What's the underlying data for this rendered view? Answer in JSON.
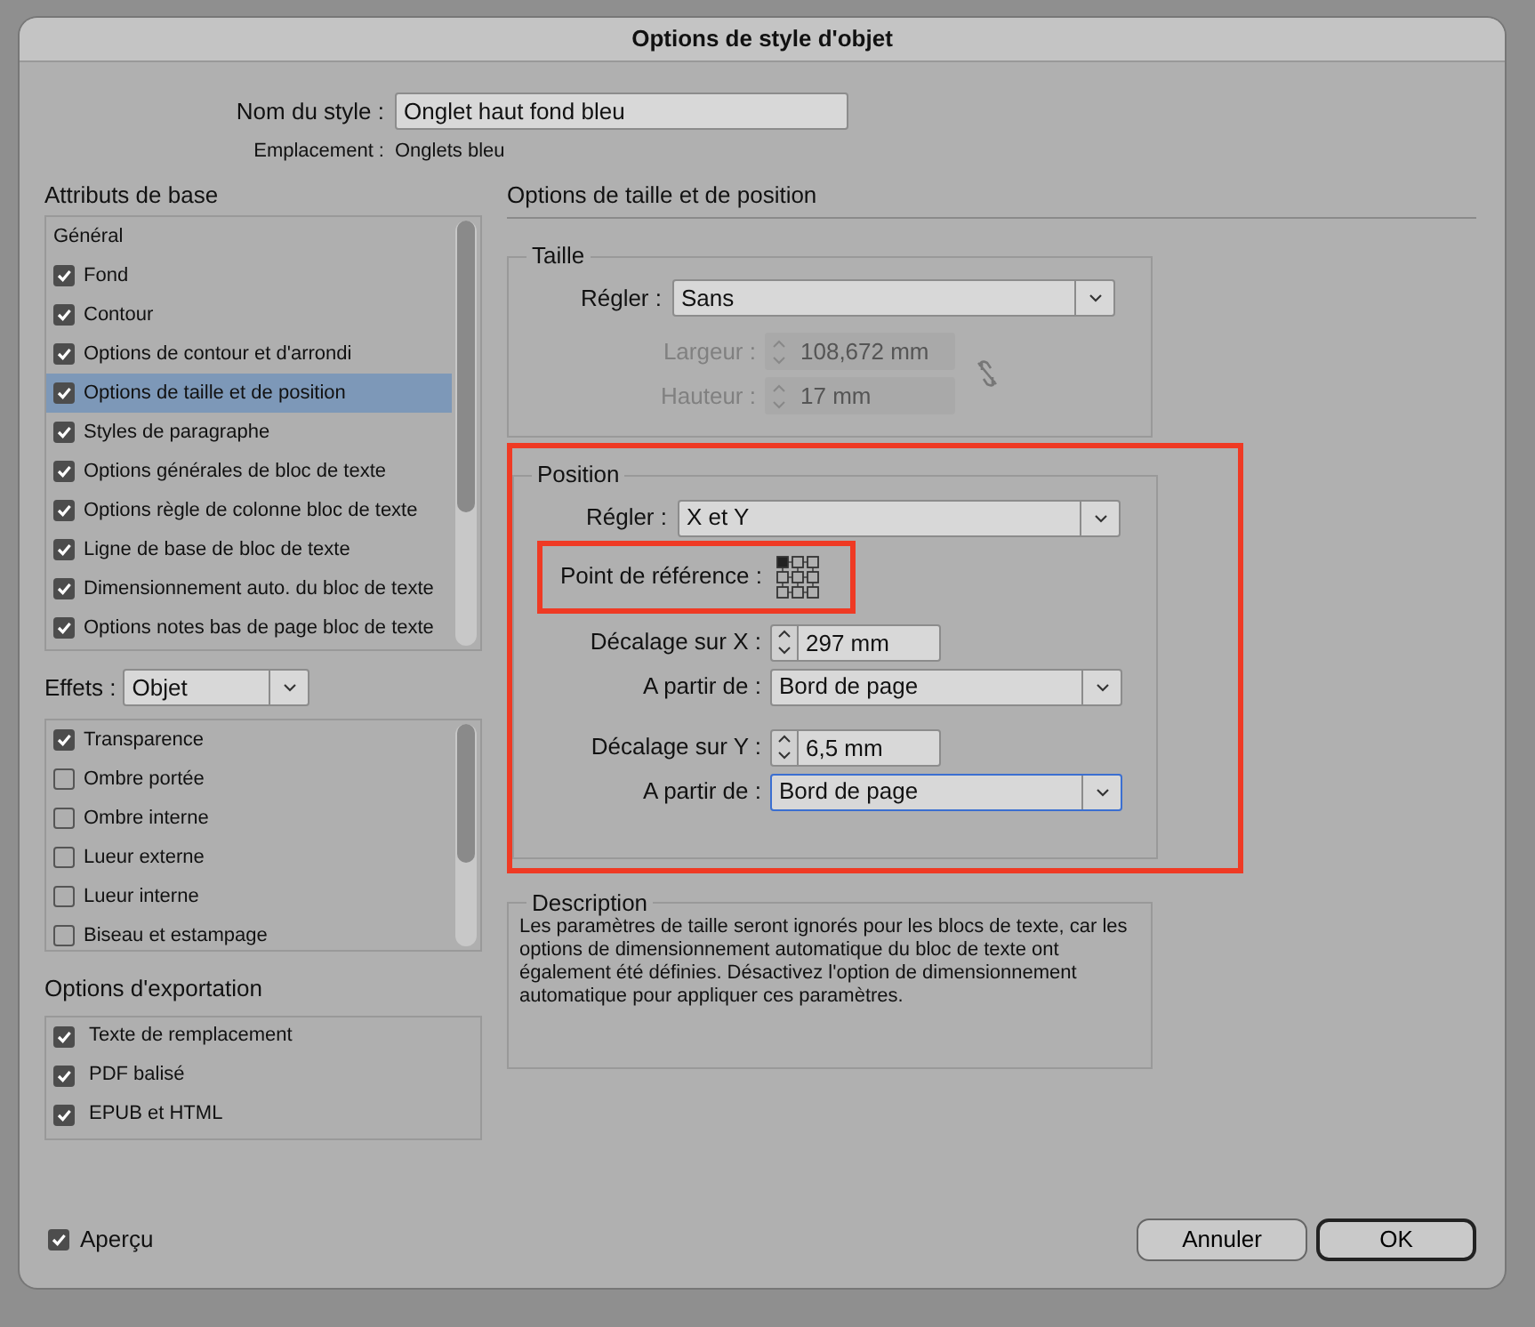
{
  "window": {
    "title": "Options de style d'objet"
  },
  "style_name": {
    "label": "Nom du style :",
    "value": "Onglet haut fond bleu"
  },
  "location": {
    "label": "Emplacement :",
    "value": "Onglets bleu"
  },
  "base_attributes": {
    "title": "Attributs de base",
    "items": [
      {
        "label": "Général",
        "kind": "header",
        "selected": false
      },
      {
        "label": "Fond",
        "kind": "check",
        "checked": true,
        "selected": false
      },
      {
        "label": "Contour",
        "kind": "check",
        "checked": true,
        "selected": false
      },
      {
        "label": "Options de contour et d'arrondi",
        "kind": "check",
        "checked": true,
        "selected": false
      },
      {
        "label": "Options de taille et de position",
        "kind": "check",
        "checked": true,
        "selected": true
      },
      {
        "label": "Styles de paragraphe",
        "kind": "check",
        "checked": true,
        "selected": false
      },
      {
        "label": "Options générales de bloc de texte",
        "kind": "check",
        "checked": true,
        "selected": false
      },
      {
        "label": "Options règle de colonne bloc de texte",
        "kind": "check",
        "checked": true,
        "selected": false
      },
      {
        "label": "Ligne de base de bloc de texte",
        "kind": "check",
        "checked": true,
        "selected": false
      },
      {
        "label": "Dimensionnement auto. du bloc de texte",
        "kind": "check",
        "checked": true,
        "selected": false
      },
      {
        "label": "Options notes bas de page bloc de texte",
        "kind": "check",
        "checked": true,
        "selected": false
      }
    ]
  },
  "effects": {
    "label": "Effets :",
    "value": "Objet",
    "items": [
      {
        "label": "Transparence",
        "checked": true
      },
      {
        "label": "Ombre portée",
        "checked": false
      },
      {
        "label": "Ombre interne",
        "checked": false
      },
      {
        "label": "Lueur externe",
        "checked": false
      },
      {
        "label": "Lueur interne",
        "checked": false
      },
      {
        "label": "Biseau et estampage",
        "checked": false
      }
    ]
  },
  "export_options": {
    "title": "Options d'exportation",
    "items": [
      {
        "label": "Texte de remplacement",
        "checked": true
      },
      {
        "label": "PDF balisé",
        "checked": true
      },
      {
        "label": "EPUB et HTML",
        "checked": true
      }
    ]
  },
  "preview": {
    "label": "Aperçu",
    "checked": true
  },
  "buttons": [
    {
      "label": "Annuler",
      "default": false
    },
    {
      "label": "OK",
      "default": true
    }
  ],
  "size_position": {
    "title": "Options de taille et de position",
    "size": {
      "title": "Taille",
      "fit": {
        "label": "Régler :",
        "value": "Sans"
      },
      "width": {
        "label": "Largeur :",
        "value": "108,672 mm",
        "disabled": true
      },
      "height": {
        "label": "Hauteur :",
        "value": "17 mm",
        "disabled": true
      }
    },
    "position": {
      "title": "Position",
      "highlighted": true,
      "fit": {
        "label": "Régler :",
        "value": "X et Y"
      },
      "reference_point": {
        "label": "Point de référence :",
        "highlighted": true,
        "points": [
          {
            "selected": true
          },
          {
            "selected": false
          },
          {
            "selected": false
          },
          {
            "selected": false
          },
          {
            "selected": false
          },
          {
            "selected": false
          },
          {
            "selected": false
          },
          {
            "selected": false
          },
          {
            "selected": false
          }
        ]
      },
      "x_offset": {
        "label": "Décalage sur X :",
        "value": "297 mm"
      },
      "x_from": {
        "label": "A partir de :",
        "value": "Bord de page",
        "focused": false
      },
      "y_offset": {
        "label": "Décalage sur Y :",
        "value": "6,5 mm"
      },
      "y_from": {
        "label": "A partir de :",
        "value": "Bord de page",
        "focused": true
      }
    },
    "description": {
      "title": "Description",
      "text": "Les paramètres de taille seront ignorés pour les blocs de texte, car les options de dimensionnement automatique du bloc de texte ont également été définies. Désactivez l'option de dimensionnement automatique pour appliquer ces paramètres."
    }
  }
}
